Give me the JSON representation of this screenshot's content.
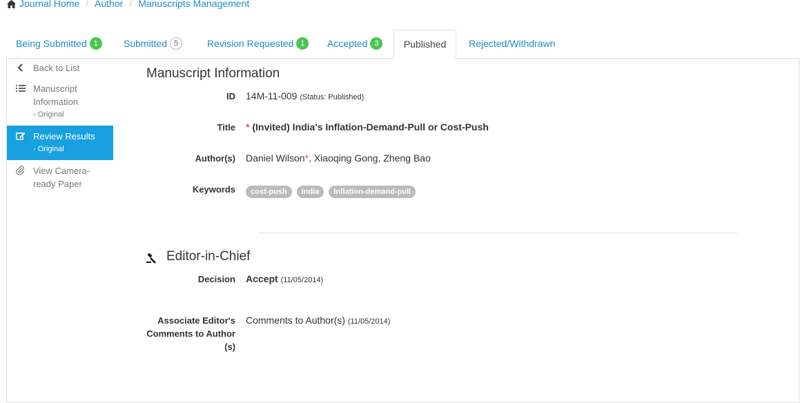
{
  "breadcrumb": {
    "items": [
      "Journal Home",
      "Author",
      "Manuscripts Management"
    ],
    "separator": "/"
  },
  "tabs": [
    {
      "label": "Being Submitted",
      "badge": "1",
      "badge_style": "green"
    },
    {
      "label": "Submitted",
      "badge": "5",
      "badge_style": "outline"
    },
    {
      "label": "Revision Requested",
      "badge": "1",
      "badge_style": "green"
    },
    {
      "label": "Accepted",
      "badge": "3",
      "badge_style": "green"
    },
    {
      "label": "Published",
      "active": true
    },
    {
      "label": "Rejected/Withdrawn"
    }
  ],
  "sidebar": {
    "items": [
      {
        "label": "Back to List",
        "icon": "chevron-left-icon"
      },
      {
        "label": "Manuscript Information",
        "sub": "- Original",
        "icon": "list-icon"
      },
      {
        "label": "Review Results",
        "sub": "- Original",
        "icon": "edit-icon",
        "active": true
      },
      {
        "label": "View Camera-ready Paper",
        "icon": "paperclip-icon"
      }
    ]
  },
  "manuscript": {
    "section_title": "Manuscript Information",
    "id_label": "ID",
    "id_value": "14M-11-009",
    "id_status": "(Status: Published)",
    "title_label": "Title",
    "title_marker": "*",
    "title_value": "(Invited) India's Inflation-Demand-Pull or Cost-Push",
    "authors_label": "Author(s)",
    "author_1": "Daniel Wilson",
    "author_1_marker": "*",
    "authors_rest": ", Xiaoqing Gong, Zheng Bao",
    "keywords_label": "Keywords",
    "keywords": [
      "cost-push",
      "India",
      "Inflation-demand-pull"
    ]
  },
  "editor": {
    "section_title": "Editor-in-Chief",
    "icon": "gavel-icon",
    "decision_label": "Decision",
    "decision_value": "Accept",
    "decision_date": "(11/05/2014)",
    "comments_label_1": "Associate Editor's",
    "comments_label_2": "Comments to Author",
    "comments_label_3": "(s)",
    "comments_value": "Comments to Author(s)",
    "comments_date": "(11/05/2014)"
  },
  "colors": {
    "link": "#1d8bc8",
    "badge_green": "#4cc552",
    "active_sidebar": "#18a0e0",
    "required": "#d9534f",
    "tag": "#bbbbbb"
  }
}
